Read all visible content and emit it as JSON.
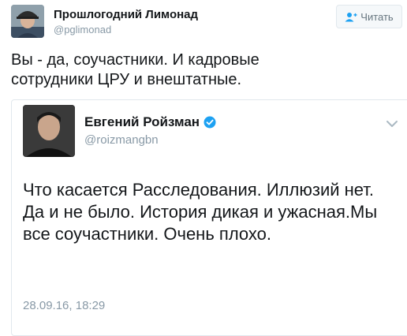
{
  "tweet": {
    "author_name": "Прошлогодний Лимонад",
    "author_handle": "@pglimonad",
    "follow_label": "Читать",
    "text": "Вы - да, соучастники. И кадровые сотрудники ЦРУ и внештатные."
  },
  "quoted_tweet": {
    "author_name": "Евгений Ройзман",
    "author_handle": "@roizmangbn",
    "verified": true,
    "text": "Что касается Расследования. Иллюзий нет. Да и не было. История дикая и ужасная.Мы все соучастники. Очень плохо.",
    "timestamp": "28.09.16, 18:29"
  },
  "colors": {
    "verified_badge": "#1da1f2",
    "secondary_text": "#8899a6",
    "border": "#e1e8ed"
  },
  "icons": {
    "follow": "add-user-icon",
    "verified": "verified-badge-icon",
    "menu": "chevron-down-icon"
  }
}
